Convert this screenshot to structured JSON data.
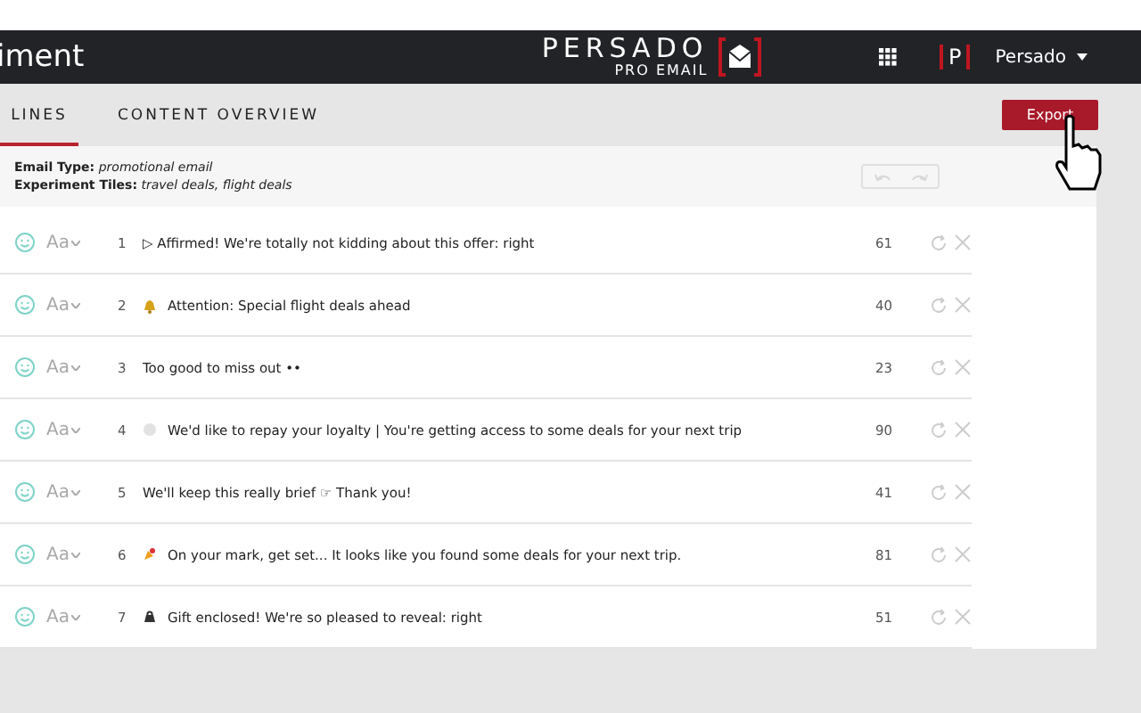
{
  "header": {
    "title": "iment",
    "brand": "PERSADO",
    "brand_sub": "PRO EMAIL",
    "avatar_letter": "P",
    "user": "Persado"
  },
  "tabs": [
    {
      "label": "LINES",
      "selected": true
    },
    {
      "label": "CONTENT OVERVIEW",
      "selected": false
    }
  ],
  "export_button": "Export",
  "info": [
    {
      "label": "Email Type:",
      "value": "promotional email"
    },
    {
      "label": "Experiment Tiles:",
      "value": "travel deals, flight deals"
    }
  ],
  "undo_redo": {
    "disabled": true
  },
  "rows": [
    {
      "style_label": "Aa",
      "number": "1",
      "kind": "plain",
      "text": "▷ Affirmed! We're totally not kidding about this offer: right",
      "score": "61"
    },
    {
      "style_label": "Aa",
      "number": "2",
      "kind": "bell",
      "text": "Attention: Special flight deals ahead",
      "score": "40"
    },
    {
      "style_label": "Aa",
      "number": "3",
      "kind": "plain",
      "text": "Too good to miss out ••",
      "score": "23"
    },
    {
      "style_label": "Aa",
      "number": "4",
      "kind": "circle",
      "text": "We'd like to repay your loyalty | You're getting access to some deals for your next trip",
      "score": "90"
    },
    {
      "style_label": "Aa",
      "number": "5",
      "kind": "plain",
      "text": "We'll keep this really brief ☞ Thank you!",
      "score": "41"
    },
    {
      "style_label": "Aa",
      "number": "6",
      "kind": "party",
      "text": "On your mark, get set... It looks like you found some deals for your next trip.",
      "score": "81"
    },
    {
      "style_label": "Aa",
      "number": "7",
      "kind": "bag",
      "text": "Gift enclosed! We're so pleased to reveal: right",
      "score": "51"
    }
  ]
}
